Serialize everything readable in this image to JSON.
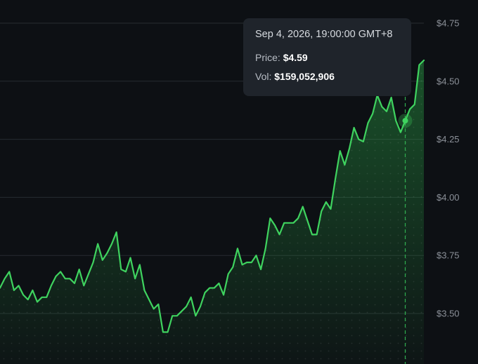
{
  "colors": {
    "background": "#0d1014",
    "line": "#3fd35f",
    "crosshair": "#2fae4f",
    "grid": "#262b31",
    "tick_text": "#8b9098",
    "tooltip_bg": "#1f242b"
  },
  "tooltip": {
    "date": "Sep 4, 2026, 19:00:00 GMT+8",
    "price_label": "Price:",
    "price_value": "$4.59",
    "vol_label": "Vol:",
    "vol_value": "$159,052,906"
  },
  "chart_data": {
    "type": "area",
    "yticks": [
      3.5,
      3.75,
      4.0,
      4.25,
      4.5,
      4.75
    ],
    "ytick_labels": [
      "$3.50",
      "$3.75",
      "$4.00",
      "$4.25",
      "$4.50",
      "$4.75"
    ],
    "ylim": [
      3.5,
      4.75
    ],
    "grid": true,
    "highlight_index": 87,
    "series": [
      {
        "values": [
          3.61,
          3.65,
          3.68,
          3.6,
          3.62,
          3.58,
          3.56,
          3.6,
          3.55,
          3.57,
          3.57,
          3.62,
          3.66,
          3.68,
          3.65,
          3.65,
          3.63,
          3.69,
          3.62,
          3.67,
          3.72,
          3.8,
          3.73,
          3.76,
          3.8,
          3.85,
          3.69,
          3.68,
          3.74,
          3.65,
          3.71,
          3.6,
          3.56,
          3.52,
          3.54,
          3.42,
          3.42,
          3.49,
          3.49,
          3.51,
          3.53,
          3.57,
          3.49,
          3.53,
          3.59,
          3.61,
          3.61,
          3.63,
          3.58,
          3.67,
          3.7,
          3.78,
          3.71,
          3.72,
          3.72,
          3.75,
          3.69,
          3.78,
          3.91,
          3.88,
          3.84,
          3.89,
          3.89,
          3.89,
          3.91,
          3.96,
          3.9,
          3.84,
          3.84,
          3.94,
          3.98,
          3.95,
          4.08,
          4.2,
          4.14,
          4.21,
          4.3,
          4.25,
          4.24,
          4.32,
          4.36,
          4.44,
          4.39,
          4.37,
          4.43,
          4.33,
          4.28,
          4.33,
          4.38,
          4.4,
          4.57,
          4.59
        ]
      }
    ]
  }
}
